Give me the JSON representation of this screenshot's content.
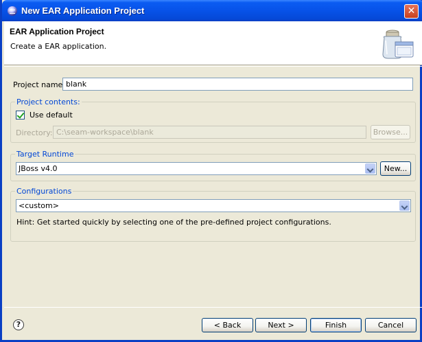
{
  "window": {
    "title": "New EAR Application Project",
    "close_glyph": "✕"
  },
  "banner": {
    "title": "EAR Application Project",
    "description": "Create a EAR application.",
    "icon": "jar-window-wizard-icon"
  },
  "form": {
    "project_name_label": "Project name:",
    "project_name_value": "blank",
    "project_contents": {
      "legend": "Project contents:",
      "use_default_label": "Use default",
      "use_default_checked": true,
      "directory_label": "Directory:",
      "directory_value": "C:\\seam-workspace\\blank",
      "browse_label": "Browse..."
    },
    "target_runtime": {
      "legend": "Target Runtime",
      "selected": "JBoss v4.0",
      "new_label": "New..."
    },
    "configurations": {
      "legend": "Configurations",
      "selected": "<custom>",
      "hint": "Hint: Get started quickly by selecting one of the pre-defined project configurations."
    }
  },
  "footer": {
    "help_glyph": "?",
    "back_label": "< Back",
    "next_label": "Next >",
    "finish_label": "Finish",
    "cancel_label": "Cancel"
  }
}
